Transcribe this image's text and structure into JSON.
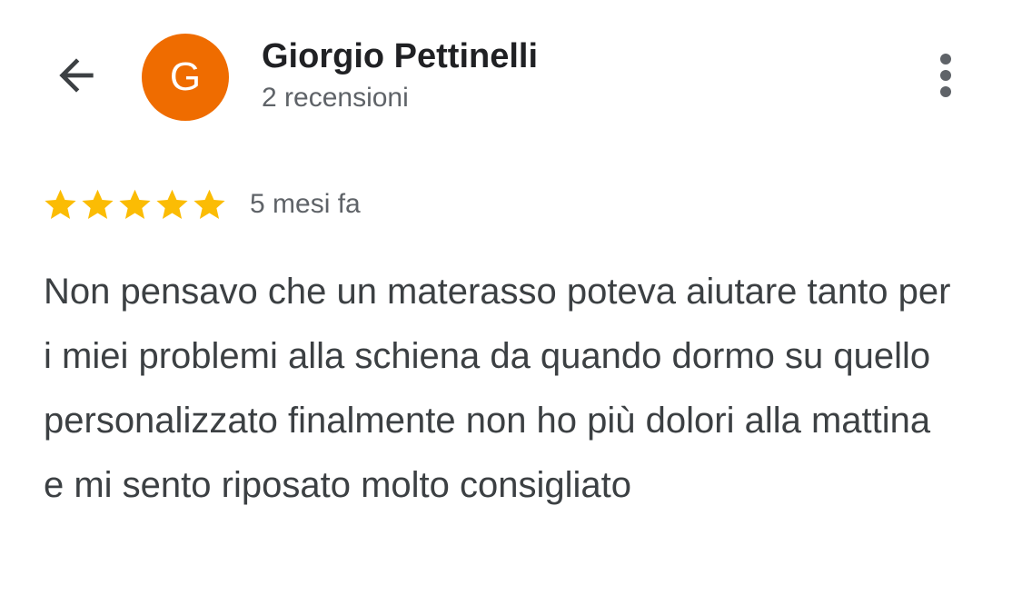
{
  "header": {
    "back_icon": "arrow-back-icon",
    "avatar_letter": "G",
    "avatar_color": "#ef6c00",
    "author_name": "Giorgio Pettinelli",
    "review_count": "2 recensioni",
    "more_icon": "more-vert-icon"
  },
  "review": {
    "rating": 5,
    "rating_max": 5,
    "star_color": "#fbbc04",
    "time_ago": "5 mesi fa",
    "text": "Non pensavo che un materasso poteva aiutare tanto per i miei problemi alla schiena da quando dormo su quello personalizzato finalmente non ho più dolori alla mattina e mi sento riposato molto consigliato"
  }
}
